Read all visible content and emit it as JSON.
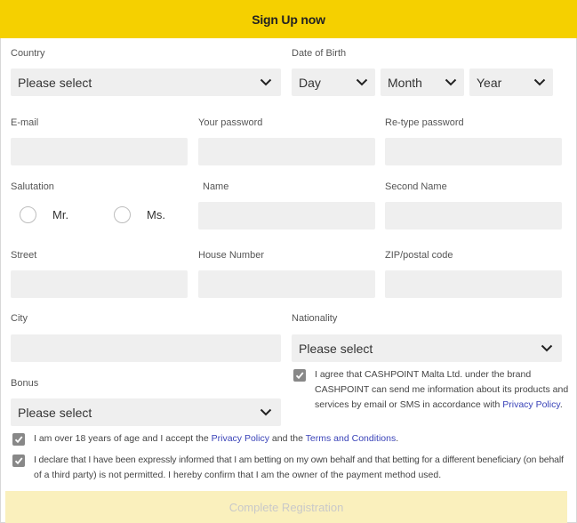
{
  "header": {
    "title": "Sign Up now"
  },
  "country": {
    "label": "Country",
    "value": "Please select"
  },
  "dob": {
    "label": "Date of Birth",
    "day": "Day",
    "month": "Month",
    "year": "Year"
  },
  "email": {
    "label": "E-mail",
    "value": ""
  },
  "password": {
    "label": "Your password",
    "value": ""
  },
  "retype": {
    "label": "Re-type password",
    "value": ""
  },
  "salutation": {
    "label": "Salutation",
    "mr": "Mr.",
    "ms": "Ms."
  },
  "name": {
    "label": "Name",
    "value": ""
  },
  "second_name": {
    "label": "Second Name",
    "value": ""
  },
  "street": {
    "label": "Street",
    "value": ""
  },
  "house_number": {
    "label": "House Number",
    "value": ""
  },
  "zip": {
    "label": "ZIP/postal code",
    "value": ""
  },
  "city": {
    "label": "City",
    "value": ""
  },
  "nationality": {
    "label": "Nationality",
    "value": "Please select"
  },
  "bonus": {
    "label": "Bonus",
    "value": "Please select"
  },
  "consent_marketing": {
    "checked": true,
    "line1": "I agree that CASHPOINT Malta Ltd. under the brand",
    "line2": "CASHPOINT can send me information about its products and",
    "line3_pre": "services by email or SMS in accordance with ",
    "line3_link": "Privacy Policy",
    "line3_post": "."
  },
  "consent_age": {
    "checked": true,
    "pre": "I am over 18 years of age and I accept the ",
    "link1": "Privacy Policy",
    "mid": " and the ",
    "link2": "Terms and Conditions",
    "post": "."
  },
  "consent_declare": {
    "checked": true,
    "line1": "I declare that I have been expressly informed that I am betting on my own behalf and that betting for a different beneficiary (on behalf",
    "line2": "of a third party) is not permitted. I hereby confirm that I am the owner of the payment method used."
  },
  "submit": {
    "label": "Complete Registration"
  },
  "colors": {
    "brand": "#f5d000",
    "field": "#efefef",
    "link": "#3a43b8",
    "submit_disabled": "#faf0bd"
  }
}
